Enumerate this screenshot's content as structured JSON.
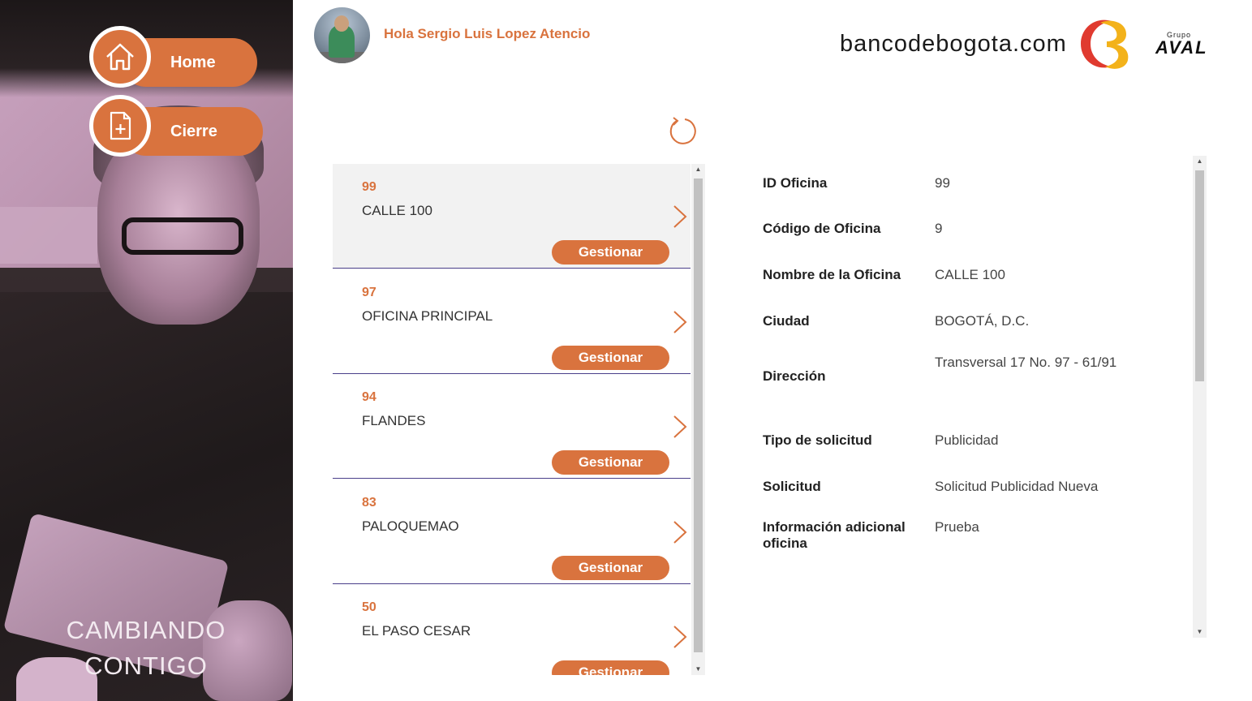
{
  "nav": {
    "home_label": "Home",
    "cierre_label": "Cierre"
  },
  "hero": {
    "tagline_line1": "CAMBIANDO",
    "tagline_line2": "CONTIGO"
  },
  "header": {
    "greeting": "Hola Sergio Luis Lopez Atencio",
    "brand_url": "bancodebogota.com",
    "aval_grupo": "Grupo",
    "aval_name": "AVAL"
  },
  "offices": [
    {
      "id": "99",
      "name": "CALLE 100",
      "action": "Gestionar",
      "selected": true
    },
    {
      "id": "97",
      "name": "OFICINA PRINCIPAL",
      "action": "Gestionar",
      "selected": false
    },
    {
      "id": "94",
      "name": "FLANDES",
      "action": "Gestionar",
      "selected": false
    },
    {
      "id": "83",
      "name": "PALOQUEMAO",
      "action": "Gestionar",
      "selected": false
    },
    {
      "id": "50",
      "name": "EL PASO CESAR",
      "action": "Gestionar",
      "selected": false
    }
  ],
  "detail": [
    {
      "label": "ID Oficina",
      "value": "99"
    },
    {
      "label": "Código de Oficina",
      "value": "9"
    },
    {
      "label": "Nombre de la Oficina",
      "value": "CALLE 100"
    },
    {
      "label": "Ciudad",
      "value": "BOGOTÁ, D.C."
    },
    {
      "label": "Dirección",
      "value": "Transversal 17 No. 97 - 61/91"
    },
    {
      "label": "Tipo de solicitud",
      "value": "Publicidad"
    },
    {
      "label": "Solicitud",
      "value": "Solicitud Publicidad Nueva"
    },
    {
      "label": "Información adicional oficina",
      "value": "Prueba"
    }
  ],
  "colors": {
    "accent": "#d9733e",
    "divider": "#4a3f8a",
    "selected_bg": "#f2f2f2"
  },
  "icons": {
    "home": "home-icon",
    "cierre": "file-plus-icon",
    "refresh": "refresh-icon",
    "chevron": "chevron-right-icon"
  }
}
